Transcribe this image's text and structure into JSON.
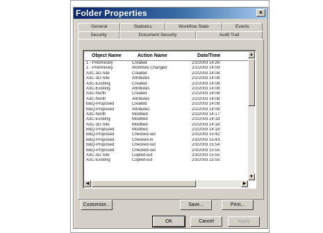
{
  "window": {
    "title": "Folder Properties",
    "close_glyph": "×"
  },
  "tabs": {
    "row1": [
      "General",
      "Statistics",
      "Workflow State",
      "Events"
    ],
    "row2": [
      "Security",
      "Document Security",
      "Audit Trail"
    ],
    "active": "Audit Trail"
  },
  "table": {
    "headers": [
      "Object Name",
      "Action Name",
      "Date/Time"
    ],
    "rows": [
      [
        "1 - Preliminary",
        "Created",
        "2/2/2003 14:26:"
      ],
      [
        "1 - Preliminary",
        "Workflow Changed",
        "2/2/2003 14:09:"
      ],
      [
        "A3C-3D-Site",
        "Created",
        "2/2/2003 14:08:"
      ],
      [
        "A3C-3D-Site",
        "Attributes",
        "2/2/2003 14:08:"
      ],
      [
        "A3C-Existing",
        "Created",
        "2/2/2003 14:08:"
      ],
      [
        "A3C-Existing",
        "Attributes",
        "2/2/2003 14:08:"
      ],
      [
        "A3C-North",
        "Created",
        "2/2/2003 14:08:"
      ],
      [
        "A3C-North",
        "Attributes",
        "2/2/2003 14:08:"
      ],
      [
        "B&Q-Proposed",
        "Created",
        "2/2/2003 14:08:"
      ],
      [
        "B&Q-Proposed",
        "Attributes",
        "2/2/2003 14:08:"
      ],
      [
        "A3C-North",
        "Modified",
        "2/2/2003 14:17:"
      ],
      [
        "A3C-Existing",
        "Modified",
        "2/2/2003 14:18:"
      ],
      [
        "A3C-3D-Site",
        "Modified",
        "2/2/2003 14:18:"
      ],
      [
        "B&Q-Proposed",
        "Modified",
        "2/2/2003 14:18:"
      ],
      [
        "B&Q-Proposed",
        "Checked-out",
        "2/3/2003 15:42:"
      ],
      [
        "B&Q-Proposed",
        "Checked-in",
        "2/3/2003 15:43:"
      ],
      [
        "B&Q-Proposed",
        "Checked-out",
        "2/3/2003 15:54:"
      ],
      [
        "B&Q-Proposed",
        "Checked-out",
        "2/3/2003 15:55:"
      ],
      [
        "A3C-3D-Site",
        "Copied-out",
        "2/3/2003 15:55:"
      ],
      [
        "A3C-Existing",
        "Copied-out",
        "2/3/2003 15:55:"
      ]
    ]
  },
  "buttons": {
    "customize": "Customize...",
    "save": "Save...",
    "print": "Print...",
    "ok": "OK",
    "cancel": "Cancel",
    "apply": "Apply"
  },
  "scroll": {
    "up": "▲",
    "down": "▼",
    "left": "◀",
    "right": "▶"
  }
}
